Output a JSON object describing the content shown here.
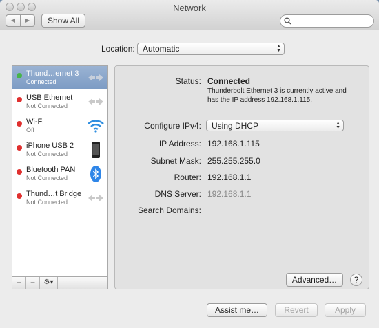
{
  "window": {
    "title": "Network"
  },
  "toolbar": {
    "show_all_label": "Show All",
    "back_glyph": "◀",
    "forward_glyph": "▶",
    "search_placeholder": ""
  },
  "location": {
    "label": "Location:",
    "value": "Automatic"
  },
  "services": [
    {
      "name": "Thund…ernet 3",
      "status": "Connected",
      "dot": "#47b44a",
      "icon": "ethernet-arrows-icon",
      "selected": true
    },
    {
      "name": "USB Ethernet",
      "status": "Not Connected",
      "dot": "#e0302f",
      "icon": "ethernet-arrows-icon",
      "selected": false
    },
    {
      "name": "Wi-Fi",
      "status": "Off",
      "dot": "#e0302f",
      "icon": "wifi-icon",
      "selected": false
    },
    {
      "name": "iPhone USB 2",
      "status": "Not Connected",
      "dot": "#e0302f",
      "icon": "iphone-icon",
      "selected": false
    },
    {
      "name": "Bluetooth PAN",
      "status": "Not Connected",
      "dot": "#e0302f",
      "icon": "bluetooth-icon",
      "selected": false
    },
    {
      "name": "Thund…t Bridge",
      "status": "Not Connected",
      "dot": "#e0302f",
      "icon": "ethernet-arrows-icon",
      "selected": false
    }
  ],
  "sidebar_tools": {
    "add": "+",
    "remove": "−",
    "gear": "⚙▾"
  },
  "detail": {
    "status_label": "Status:",
    "status_value": "Connected",
    "status_desc": "Thunderbolt Ethernet 3 is currently active and has the IP address 192.168.1.115.",
    "configure_label": "Configure IPv4:",
    "configure_value": "Using DHCP",
    "ip_label": "IP Address:",
    "ip_value": "192.168.1.115",
    "subnet_label": "Subnet Mask:",
    "subnet_value": "255.255.255.0",
    "router_label": "Router:",
    "router_value": "192.168.1.1",
    "dns_label": "DNS Server:",
    "dns_value": "192.168.1.1",
    "search_domains_label": "Search Domains:",
    "advanced_label": "Advanced…",
    "help_label": "?"
  },
  "footer": {
    "assist_label": "Assist me…",
    "revert_label": "Revert",
    "apply_label": "Apply"
  },
  "colors": {
    "connected": "#47b44a",
    "disconnected": "#e0302f",
    "selection": "#7c9bc4",
    "wifi": "#2e8ee0",
    "bluetooth": "#2f86e8"
  }
}
